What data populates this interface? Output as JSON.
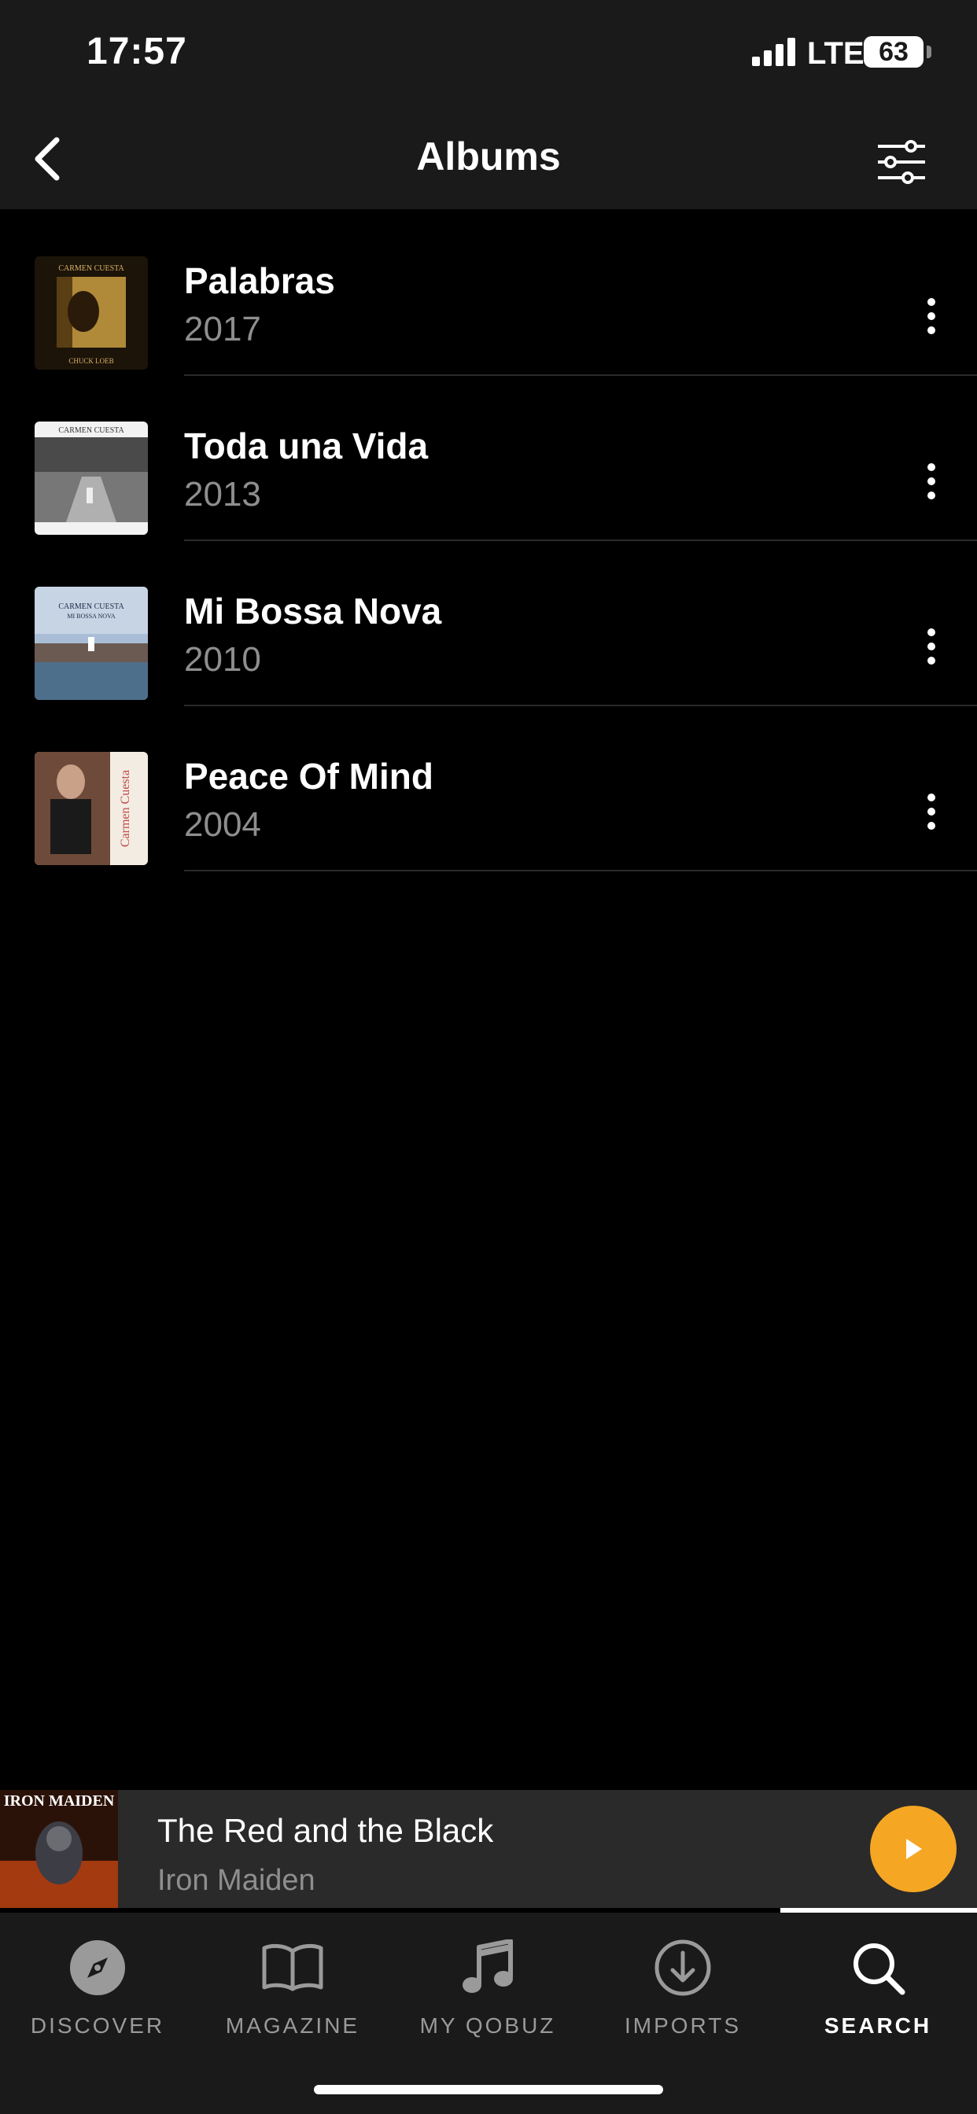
{
  "status_bar": {
    "time": "17:57",
    "network": "LTE",
    "battery": "63"
  },
  "header": {
    "title": "Albums",
    "back_icon": "chevron-left-icon",
    "filter_icon": "sliders-icon"
  },
  "albums": [
    {
      "title": "Palabras",
      "year": "2017",
      "cover_text": "CARMEN CUESTA",
      "cover_text_2": "CHUCK LOEB"
    },
    {
      "title": "Toda una Vida",
      "year": "2013",
      "cover_text": "CARMEN CUESTA"
    },
    {
      "title": "Mi Bossa Nova",
      "year": "2010",
      "cover_text": "CARMEN CUESTA",
      "cover_text_2": "MI BOSSA NOVA"
    },
    {
      "title": "Peace Of Mind",
      "year": "2004",
      "cover_text": "Carmen Cuesta"
    }
  ],
  "mini_player": {
    "track_title": "The Red and the Black",
    "artist": "Iron Maiden",
    "cover_text": "IRON MAIDEN",
    "accent_color": "#f5a623"
  },
  "tabs": [
    {
      "label": "DISCOVER",
      "icon": "compass-icon",
      "active": false
    },
    {
      "label": "MAGAZINE",
      "icon": "book-icon",
      "active": false
    },
    {
      "label": "MY QOBUZ",
      "icon": "music-note-icon",
      "active": false
    },
    {
      "label": "IMPORTS",
      "icon": "download-icon",
      "active": false
    },
    {
      "label": "SEARCH",
      "icon": "search-icon",
      "active": true
    }
  ]
}
